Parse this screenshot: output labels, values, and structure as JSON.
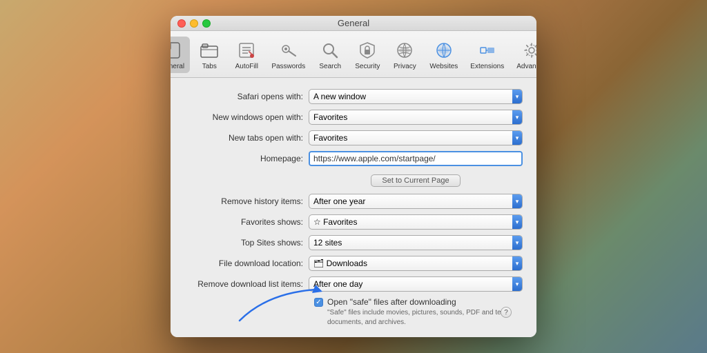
{
  "window": {
    "title": "General"
  },
  "toolbar": {
    "items": [
      {
        "id": "general",
        "label": "General",
        "active": true
      },
      {
        "id": "tabs",
        "label": "Tabs",
        "active": false
      },
      {
        "id": "autofill",
        "label": "AutoFill",
        "active": false
      },
      {
        "id": "passwords",
        "label": "Passwords",
        "active": false
      },
      {
        "id": "search",
        "label": "Search",
        "active": false
      },
      {
        "id": "security",
        "label": "Security",
        "active": false
      },
      {
        "id": "privacy",
        "label": "Privacy",
        "active": false
      },
      {
        "id": "websites",
        "label": "Websites",
        "active": false
      },
      {
        "id": "extensions",
        "label": "Extensions",
        "active": false
      },
      {
        "id": "advanced",
        "label": "Advanced",
        "active": false
      }
    ]
  },
  "form": {
    "safari_opens_with_label": "Safari opens with:",
    "safari_opens_with_value": "A new window",
    "new_windows_label": "New windows open with:",
    "new_windows_value": "Favorites",
    "new_tabs_label": "New tabs open with:",
    "new_tabs_value": "Favorites",
    "homepage_label": "Homepage:",
    "homepage_value": "https://www.apple.com/startpage/",
    "set_button_label": "Set to Current Page",
    "remove_history_label": "Remove history items:",
    "remove_history_value": "After one year",
    "favorites_shows_label": "Favorites shows:",
    "favorites_shows_value": "Favorites",
    "top_sites_label": "Top Sites shows:",
    "top_sites_value": "12 sites",
    "file_download_label": "File download location:",
    "file_download_value": "Downloads",
    "remove_download_label": "Remove download list items:",
    "remove_download_value": "After one day",
    "open_safe_label": "Open \"safe\" files after downloading",
    "open_safe_desc": "\"Safe\" files include movies, pictures, sounds, PDF and text documents, and archives."
  },
  "help": {
    "label": "?"
  }
}
